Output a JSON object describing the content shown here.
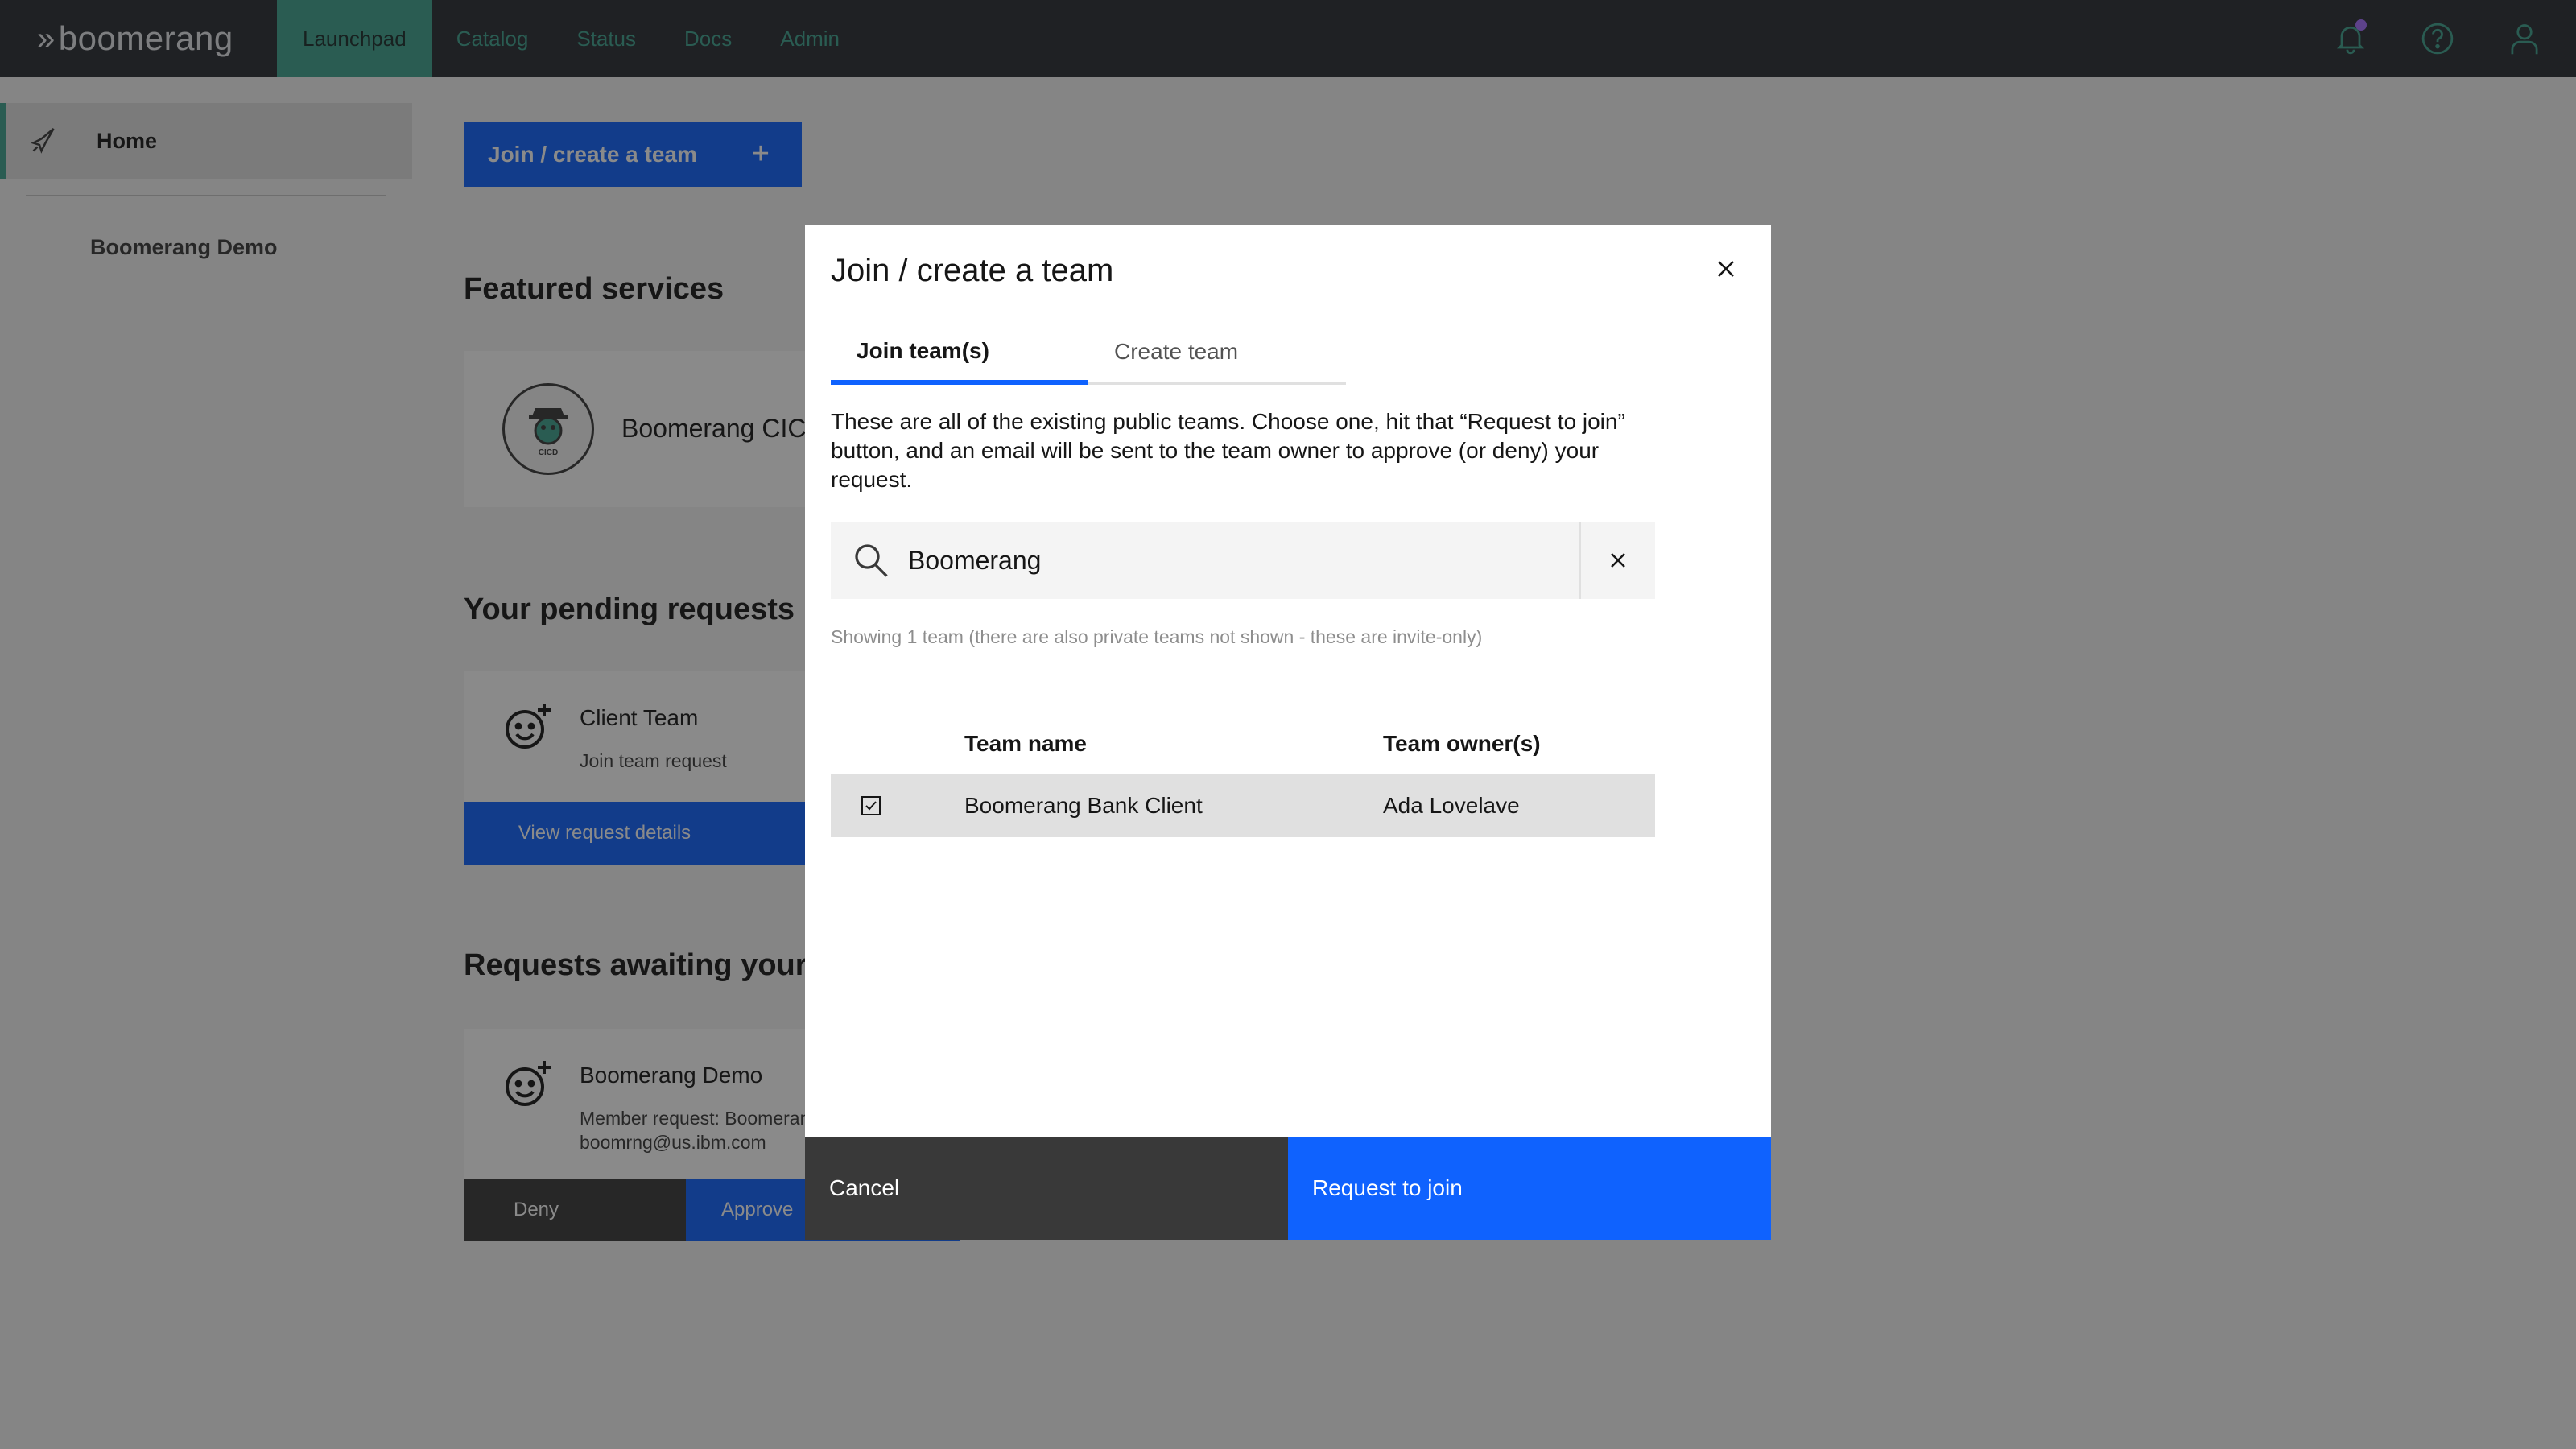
{
  "header": {
    "logo_text": "boomerang",
    "nav": [
      {
        "label": "Launchpad",
        "active": true
      },
      {
        "label": "Catalog"
      },
      {
        "label": "Status"
      },
      {
        "label": "Docs"
      },
      {
        "label": "Admin"
      }
    ],
    "icons": [
      "bell-icon",
      "help-icon",
      "user-icon"
    ]
  },
  "sidebar": {
    "home_label": "Home",
    "team_label": "Boomerang Demo"
  },
  "main": {
    "join_button_label": "Join / create a team",
    "featured_title": "Featured services",
    "featured_service_name": "Boomerang CICD",
    "cicd_logo_text": "CICD",
    "pending_title": "Your pending requests",
    "pending_card": {
      "title": "Client Team",
      "subtitle": "Join team request",
      "button_label": "View request details"
    },
    "awaiting_title": "Requests awaiting your approval",
    "awaiting_card": {
      "title": "Boomerang Demo",
      "line1": "Member request: Boomerang",
      "line2": "boomrng@us.ibm.com",
      "deny_label": "Deny",
      "approve_label": "Approve"
    }
  },
  "modal": {
    "title": "Join / create a team",
    "tabs": [
      {
        "label": "Join team(s)",
        "active": true
      },
      {
        "label": "Create team"
      }
    ],
    "description": "These are all of the existing public teams. Choose one, hit that “Request to join” button, and an email will be sent to the team owner to approve (or deny) your request.",
    "search_value": "Boomerang",
    "helper_text": "Showing 1 team (there are also private teams not shown - these are invite-only)",
    "table": {
      "headers": [
        "Team name",
        "Team owner(s)"
      ],
      "rows": [
        {
          "selected": true,
          "team_name": "Boomerang Bank Client",
          "owner": "Ada Lovelave"
        }
      ]
    },
    "cancel_label": "Cancel",
    "request_label": "Request to join"
  },
  "colors": {
    "accent_teal": "#3ea28f",
    "primary_blue": "#0f62fe",
    "header_bg": "#282d33",
    "notification_dot": "#a56eff"
  }
}
